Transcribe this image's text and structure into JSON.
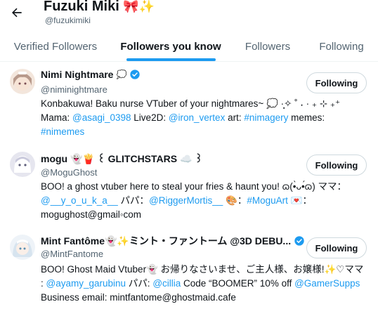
{
  "header": {
    "title": "Fuzuki Miki",
    "title_emoji": "🎀✨",
    "handle": "@fuzukimiki"
  },
  "tabs": [
    {
      "label": "Verified Followers",
      "active": false
    },
    {
      "label": "Followers you know",
      "active": true
    },
    {
      "label": "Followers",
      "active": false
    },
    {
      "label": "Following",
      "active": false
    }
  ],
  "accent_color": "#1d9bf0",
  "users": [
    {
      "name": "Nimi Nightmare",
      "name_suffix": "💭",
      "verified": true,
      "handle": "@niminightmare",
      "button": "Following",
      "bio_line1": "Konbakuwa! Baku nurse VTuber of your nightmares~ 💭 ·̩͙✧ ˚ ˖ · ₊ ⊹ ₊⁺",
      "bio_line2_parts": [
        "Mama: ",
        "@asagi_0398",
        " Live2D: ",
        "@iron_vertex",
        " art: ",
        "#nimagery",
        " memes:"
      ],
      "bio_line3": "#nimemes"
    },
    {
      "name": "mogu 👻🍟 ꒰ GLITCHSTARS ☁️ ꒱",
      "verified": false,
      "handle": "@MoguGhost",
      "button": "Following",
      "bio_line1": "BOO! a ghost vtuber here to steal your fries & haunt you! ɷ(•̀ᴗ•́ɷ) ママ：",
      "bio_line2_parts": [
        "@__y_o_u_k_a__",
        " パパ：",
        "@RiggerMortis__",
        " 🎨：",
        "#MoguArt",
        " 💌："
      ],
      "bio_line3": "mogughost@gmail◦com"
    },
    {
      "name": "Mint Fantôme👻✨ミント・ファントーム @3D DEBU...",
      "verified": true,
      "handle": "@MintFantome",
      "button": "Following",
      "bio_line1": "BOO! Ghost Maid Vtuber👻 お帰りなさいませ、ご主人様、お嬢様!✨♡ママ",
      "bio_line2_parts": [
        ": ",
        "@ayamy_garubinu",
        " パパ: ",
        "@cillia",
        " Code “BOOMER” 10% off ",
        "@GamerSupps"
      ],
      "bio_line3": "Business email: mintfantome@ghostmaid.cafe"
    }
  ]
}
